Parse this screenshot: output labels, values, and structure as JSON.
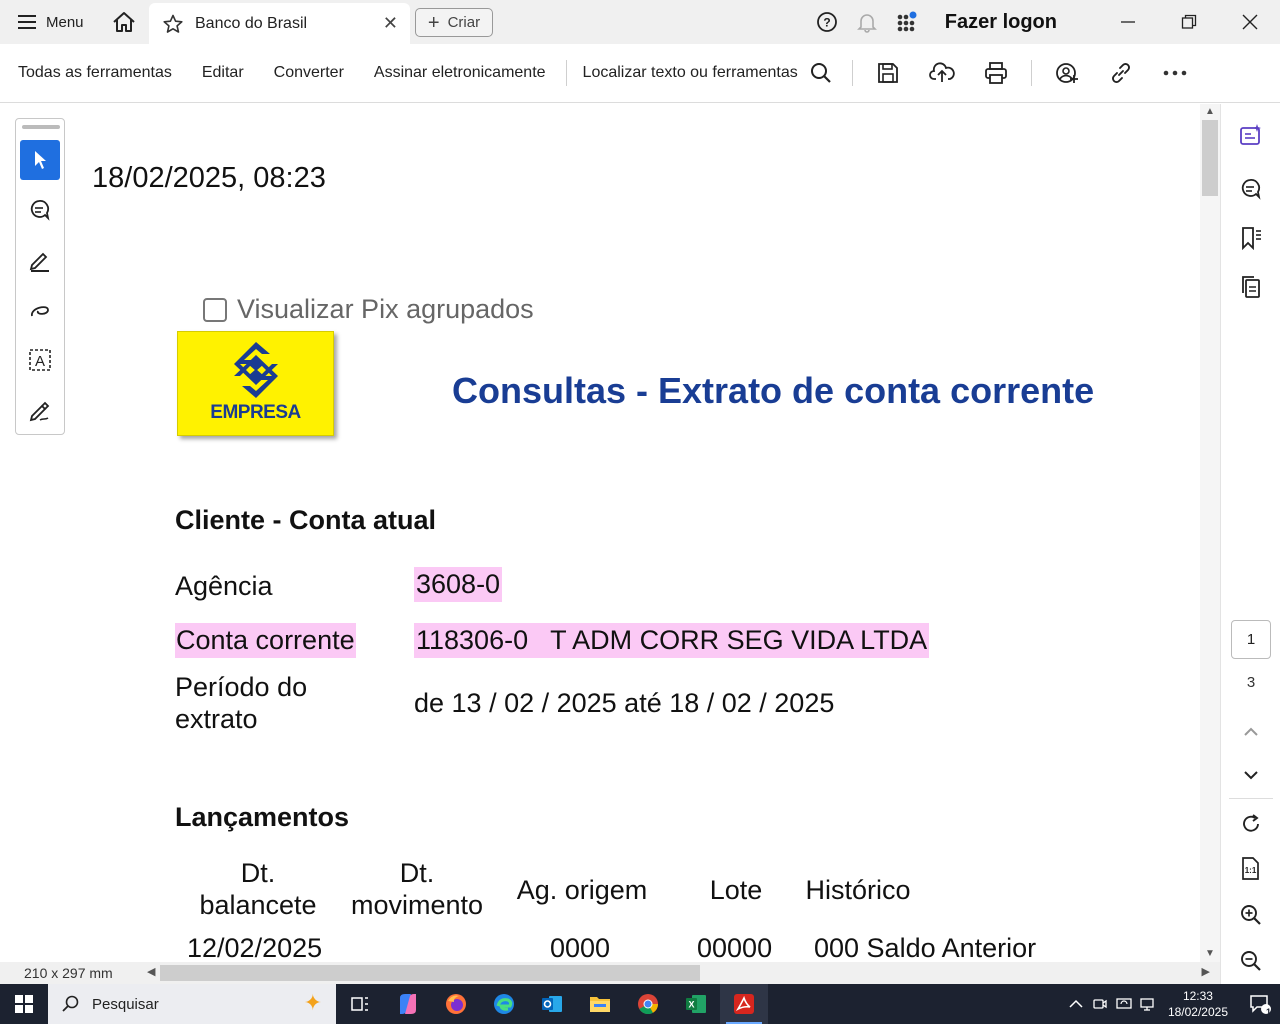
{
  "titlebar": {
    "menu_label": "Menu",
    "tab_title": "Banco do Brasil",
    "tab_close": "✕",
    "create_label": "Criar",
    "login_label": "Fazer logon"
  },
  "toolbar": {
    "all_tools": "Todas as ferramentas",
    "edit": "Editar",
    "convert": "Converter",
    "sign": "Assinar eletronicamente",
    "find": "Localizar texto ou ferramentas"
  },
  "document": {
    "timestamp": "18/02/2025, 08:23",
    "pix_checkbox_label": "Visualizar Pix agrupados",
    "logo_text": "EMPRESA",
    "title": "Consultas - Extrato de conta corrente",
    "client_section": "Cliente - Conta atual",
    "rows": [
      {
        "label": "Agência",
        "value": "3608-0"
      },
      {
        "label": "Conta corrente",
        "value": "118306-0   T ADM CORR SEG VIDA LTDA"
      },
      {
        "label": "Período do extrato",
        "value": "de 13 / 02 / 2025 até 18 / 02 / 2025"
      }
    ],
    "period_label_line1": "Período do",
    "period_label_line2": "extrato",
    "entries_section": "Lançamentos",
    "table_headers": {
      "dt_balancete_1": "Dt.",
      "dt_balancete_2": "balancete",
      "dt_movimento_1": "Dt.",
      "dt_movimento_2": "movimento",
      "ag_origem": "Ag. origem",
      "lote": "Lote",
      "historico": "Histórico"
    },
    "table_rows": [
      {
        "dt_balancete": "12/02/2025",
        "dt_movimento": "",
        "ag_origem": "0000",
        "lote": "00000",
        "historico": "000 Saldo Anterior"
      }
    ]
  },
  "right_panel": {
    "current_page": "1",
    "total_pages": "3"
  },
  "status": {
    "page_size": "210 x 297 mm"
  },
  "taskbar": {
    "search_placeholder": "Pesquisar",
    "time": "12:33",
    "date": "18/02/2025",
    "notification_count": "1"
  },
  "colors": {
    "title_blue": "#193d94",
    "highlight_pink": "#fbc9f5",
    "logo_yellow": "#fff200",
    "active_tool_blue": "#1f6fe0",
    "taskbar_bg": "#1c2230"
  }
}
